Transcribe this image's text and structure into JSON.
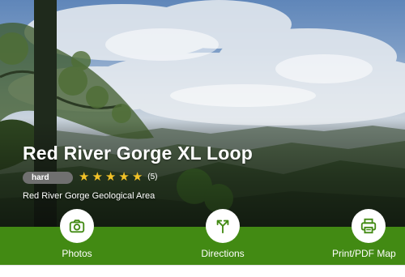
{
  "trail": {
    "title": "Red River Gorge XL Loop",
    "difficulty": "hard",
    "rating": 5,
    "review_count": "(5)",
    "area": "Red River Gorge Geological Area"
  },
  "actions": {
    "photos": {
      "label": "Photos",
      "icon": "camera-icon"
    },
    "directions": {
      "label": "Directions",
      "icon": "directions-icon"
    },
    "print": {
      "label": "Print/PDF Map",
      "icon": "printer-icon"
    }
  },
  "colors": {
    "action_bar": "#428a13",
    "star": "#f2c228",
    "badge": "#707070",
    "icon": "#428a13"
  }
}
